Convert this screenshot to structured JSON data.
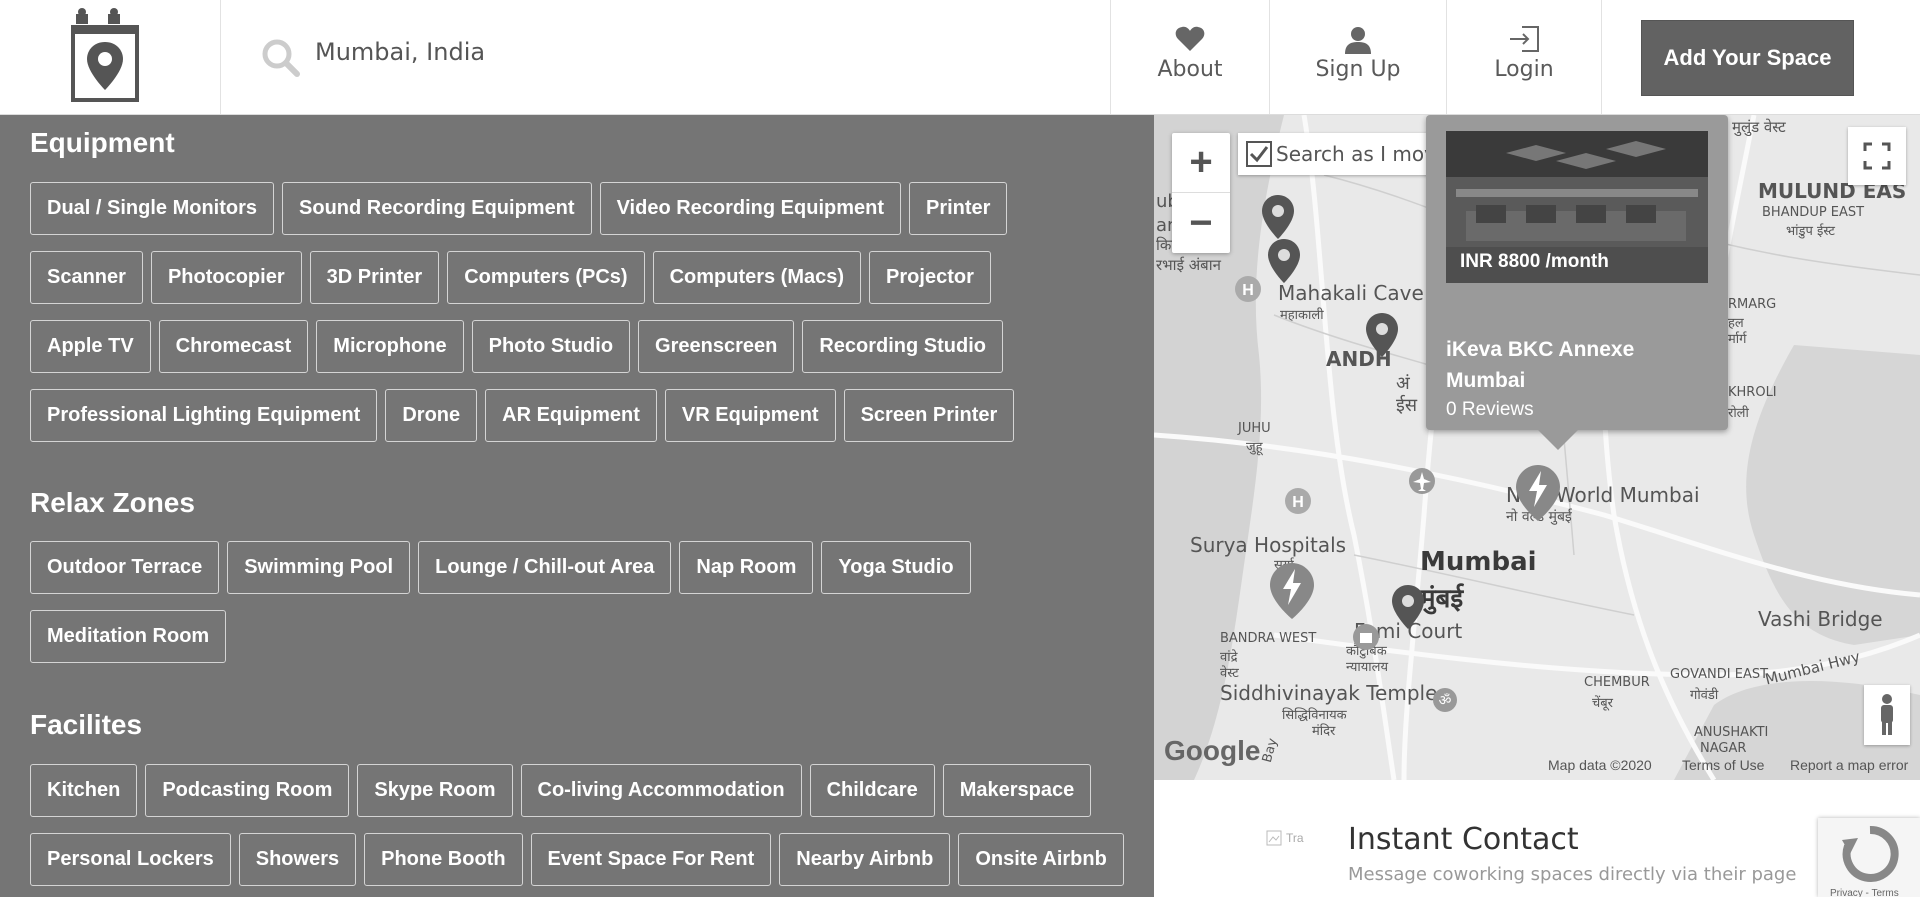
{
  "header": {
    "search": {
      "value": "Mumbai, India"
    },
    "nav": [
      {
        "label": "About",
        "icon": "heart-icon"
      },
      {
        "label": "Sign Up",
        "icon": "user-icon"
      },
      {
        "label": "Login",
        "icon": "login-icon"
      }
    ],
    "add_space_label": "Add Your Space"
  },
  "sections": [
    {
      "title": "Equipment",
      "rows": [
        [
          "Dual / Single Monitors",
          "Sound Recording Equipment",
          "Video Recording Equipment",
          "Printer"
        ],
        [
          "Scanner",
          "Photocopier",
          "3D Printer",
          "Computers (PCs)",
          "Computers (Macs)",
          "Projector"
        ],
        [
          "Apple TV",
          "Chromecast",
          "Microphone",
          "Photo Studio",
          "Greenscreen",
          "Recording Studio"
        ],
        [
          "Professional Lighting Equipment",
          "Drone",
          "AR Equipment",
          "VR Equipment",
          "Screen Printer"
        ]
      ]
    },
    {
      "title": "Relax Zones",
      "rows": [
        [
          "Outdoor Terrace",
          "Swimming Pool",
          "Lounge / Chill-out Area",
          "Nap Room",
          "Yoga Studio"
        ],
        [
          "Meditation Room"
        ]
      ]
    },
    {
      "title": "Facilites",
      "rows": [
        [
          "Kitchen",
          "Podcasting Room",
          "Skype Room",
          "Co-living Accommodation",
          "Childcare",
          "Makerspace"
        ],
        [
          "Personal Lockers",
          "Showers",
          "Phone Booth",
          "Event Space For Rent",
          "Nearby Airbnb",
          "Onsite Airbnb"
        ]
      ]
    }
  ],
  "map": {
    "search_as_move": "Search as I move the map",
    "search_as_move_checked": true,
    "zoom_in": "+",
    "zoom_out": "−",
    "card": {
      "price": "INR 8800 /month",
      "name": "iKeva BKC Annexe Mumbai",
      "reviews": "0 Reviews"
    },
    "labels": {
      "mulund_dev": "मुलुंड वेस्ट",
      "mulund": "MULUND EAS",
      "bhandup": "BHANDUP EAST",
      "bhandup_dev": "भांडुप ईस्ट",
      "subhash": "ubh",
      "anch": "anc",
      "killa": "किल्ला",
      "andheri_snip": "रभाई अंबान",
      "mahakali": "Mahakali Cave",
      "mahakali_dev": "महाकाली",
      "andheri": "ANDH",
      "a_dev": "अं",
      "is_dev": "ईस",
      "juhu": "JUHU",
      "juhu_dev": "जुहू",
      "marg": "RMARG",
      "hlm": "हल",
      "marag": "र्मार्ग",
      "kholi": "KHROLI",
      "rali": "रोली",
      "now_world": "Now World Mumbai",
      "now_world_dev": "नो वर्ल्ड मुंबई",
      "surya": "Surya Hospitals",
      "surya_dev": "सूर्या",
      "mumbai": "Mumbai",
      "mumbai_dev": "मुंबई",
      "family_court": "Fami    Court",
      "vashi": "Vashi Bridge",
      "bandra": "BANDRA WEST",
      "bandra_dev": "वांद्रे",
      "bandra_dev2": "वेस्ट",
      "kautumbik": "कौटुंबिक",
      "nyayalay": "न्यायालय",
      "chembur": "CHEMBUR",
      "chembur_dev": "चेंबूर",
      "govandi": "GOVANDI EAST",
      "govandi_dev": "गोवंडी",
      "mumbai_hwy": "Mumbai Hwy",
      "siddhivinayak": "Siddhivinayak Temple",
      "siddhivinayak_dev": "सिद्धिविनायक",
      "mandir": "मंदिर",
      "anushakti": "ANUSHAKTI",
      "nagar": "NAGAR",
      "bay": "Bay"
    },
    "google": "Google",
    "map_data": "Map data ©2020",
    "terms": "Terms of Use",
    "report": "Report a map error"
  },
  "contact": {
    "img_alt": "Tra",
    "title": "Instant Contact",
    "subtitle": "Message coworking spaces directly via their page"
  },
  "recaptcha": {
    "footer": "Privacy - Terms"
  }
}
